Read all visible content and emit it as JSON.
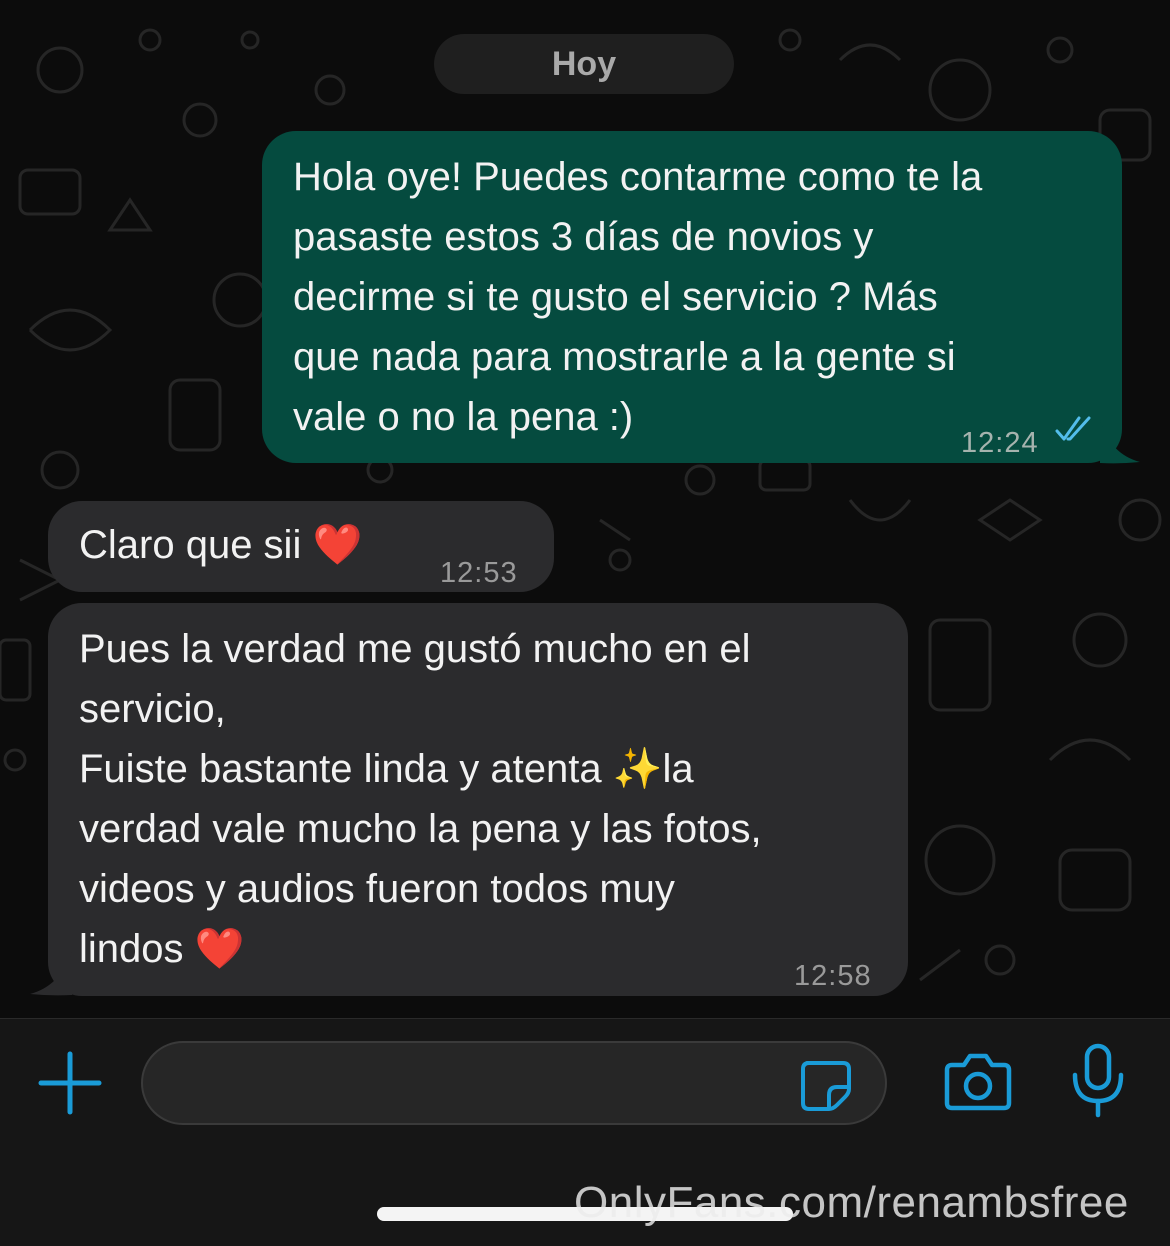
{
  "header": {
    "date_chip": "Hoy"
  },
  "messages": [
    {
      "direction": "outgoing",
      "lines": [
        "Hola oye! Puedes contarme como te la",
        "pasaste estos 3 días de novios y",
        "decirme si te gusto el servicio ? Más",
        "que nada para mostrarle a la gente si",
        "vale o no la pena :)"
      ],
      "time": "12:24",
      "status_icon": "double-check-read-icon"
    },
    {
      "direction": "incoming",
      "lines": [
        "Claro que sii ❤️"
      ],
      "time": "12:53"
    },
    {
      "direction": "incoming",
      "lines": [
        "Pues la verdad me gustó mucho en el",
        "servicio,",
        "Fuiste bastante linda y atenta ✨la",
        "verdad vale mucho la pena y las fotos,",
        "videos y audios fueron todos muy",
        "lindos ❤️"
      ],
      "time": "12:58"
    }
  ],
  "composer": {
    "input_value": "",
    "icons": [
      "plus-icon",
      "sticker-icon",
      "camera-icon",
      "microphone-icon"
    ]
  },
  "watermark": "OnlyFans.com/renambsfree",
  "colors": {
    "outgoing_bubble": "#054b3f",
    "incoming_bubble": "#2b2b2d",
    "accent_icon": "#1a9bd7",
    "read_check": "#53bdeb"
  }
}
